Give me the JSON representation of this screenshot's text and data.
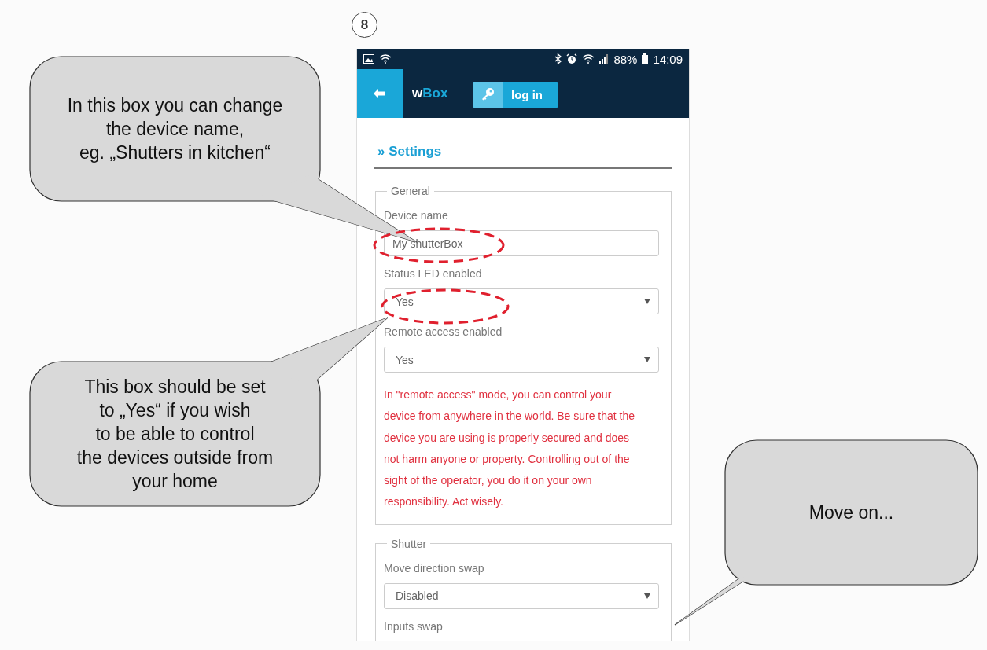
{
  "step": {
    "number": "8"
  },
  "status_bar": {
    "battery": "88%",
    "time": "14:09"
  },
  "header": {
    "title_prefix": "w",
    "title_brand": "Box",
    "login_label": "log in"
  },
  "section": {
    "title": "» Settings"
  },
  "groups": [
    {
      "legend": "General",
      "fields": [
        {
          "kind": "text",
          "label": "Device name",
          "value": "My shutterBox"
        },
        {
          "kind": "select",
          "label": "Status LED enabled",
          "value": "Yes"
        },
        {
          "kind": "select",
          "label": "Remote access enabled",
          "value": "Yes"
        }
      ],
      "note": "In \"remote access\" mode, you can control your device from anywhere in the world. Be sure that the device you are using is properly secured and does not harm anyone or property. Controlling out of the sight of the operator, you do it on your own responsibility. Act wisely."
    },
    {
      "legend": "Shutter",
      "fields": [
        {
          "kind": "select",
          "label": "Move direction swap",
          "value": "Disabled"
        },
        {
          "kind": "label",
          "label": "Inputs swap"
        }
      ]
    }
  ],
  "callouts": [
    {
      "text": "In this box you can change\nthe device name,\neg. „Shutters in kitchen“"
    },
    {
      "text": "This box should be set\nto „Yes“ if you wish\nto be able to control\nthe devices outside from\nyour home"
    },
    {
      "text": "Move on..."
    }
  ]
}
